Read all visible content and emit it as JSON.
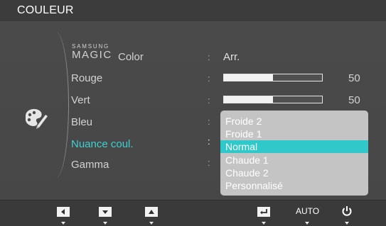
{
  "window": {
    "title": "COULEUR"
  },
  "menu": {
    "magic_color": {
      "brand_top": "SAMSUNG",
      "brand_main": "MAGIC",
      "label": "Color",
      "value": "Arr."
    },
    "rows": [
      {
        "label": "Rouge",
        "value": 50,
        "value_text": "50",
        "percent": 50
      },
      {
        "label": "Vert",
        "value": 50,
        "value_text": "50",
        "percent": 50
      },
      {
        "label": "Bleu"
      },
      {
        "label": "Nuance coul."
      },
      {
        "label": "Gamma"
      }
    ],
    "separator": ":",
    "active_row": "Nuance coul."
  },
  "dropdown": {
    "options": [
      "Froide 2",
      "Froide 1",
      "Normal",
      "Chaude 1",
      "Chaude 2",
      "Personnalisé"
    ],
    "selected": "Normal",
    "highlight_color": "#30c8c8"
  },
  "bottom_bar": {
    "buttons": [
      {
        "name": "left",
        "icon": "arrow-left-icon"
      },
      {
        "name": "down",
        "icon": "arrow-down-icon"
      },
      {
        "name": "up",
        "icon": "arrow-up-icon"
      },
      {
        "name": "enter",
        "icon": "enter-icon"
      },
      {
        "name": "auto",
        "label": "AUTO"
      },
      {
        "name": "power",
        "icon": "power-icon"
      }
    ]
  },
  "colors": {
    "accent": "#3fd0d2",
    "background": "#4a4a4a"
  },
  "icons": {
    "category": "palette-icon"
  }
}
